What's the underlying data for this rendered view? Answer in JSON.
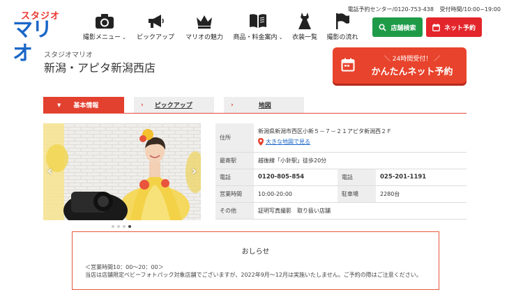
{
  "brand": {
    "logo_top": "スタジオ",
    "logo_main": "マリオ"
  },
  "topinfo": {
    "reservation_center": "電話予約センター/0120-753-438",
    "hours": "受付時間/10:00~19:00"
  },
  "nav": [
    {
      "label": "撮影メニュー",
      "icon": "camera-icon",
      "has_dropdown": true
    },
    {
      "label": "ピックアップ",
      "icon": "megaphone-icon",
      "has_dropdown": false
    },
    {
      "label": "マリオの魅力",
      "icon": "crown-icon",
      "has_dropdown": false
    },
    {
      "label": "商品・料金案内",
      "icon": "book-icon",
      "has_dropdown": true
    },
    {
      "label": "衣装一覧",
      "icon": "dress-icon",
      "has_dropdown": false
    },
    {
      "label": "撮影の流れ",
      "icon": "flag-icon",
      "has_dropdown": false
    }
  ],
  "header_buttons": {
    "store_search": "店舗検索",
    "net_reserve": "ネット予約"
  },
  "store": {
    "brand_label": "スタジオマリオ",
    "name": "新潟・アピタ新潟西店"
  },
  "big_reserve": {
    "line1": "＼ 24時間受付！ ／",
    "line2": "かんたんネット予約"
  },
  "tabs": {
    "basic": "基本情報",
    "pickup": "ピックアップ",
    "map": "地図"
  },
  "info": {
    "address_label": "住所",
    "address": "新潟県新潟市西区小新５－７－２１アピタ新潟西２Ｆ",
    "big_map_link": "大きな地図で見る",
    "station_label": "最寄駅",
    "station": "越後線「小針駅」徒歩20分",
    "phone_label": "電話",
    "phone": "0120-805-854",
    "phone2_label": "電話",
    "phone2": "025-201-1191",
    "hours_label": "営業時間",
    "hours": "10:00-20:00",
    "parking_label": "駐車場",
    "parking": "2280台",
    "other_label": "その他",
    "other": "証明写真撮影　取り扱い店舗"
  },
  "notice": {
    "title": "おしらせ",
    "line1": "＜営業時間10：00～20：00＞",
    "line2": "当店は店舗限定ベビーフォトパック対象店舗でございますが、2022年9月～12月は実施いたしません。ご予約の際はご注意ください。"
  },
  "colors": {
    "brand_blue": "#1b66c8",
    "brand_red": "#e3262c",
    "green": "#1f9b48",
    "accent_orange": "#e8432c"
  },
  "slider": {
    "total_slides": 4,
    "active_slide": 4
  }
}
